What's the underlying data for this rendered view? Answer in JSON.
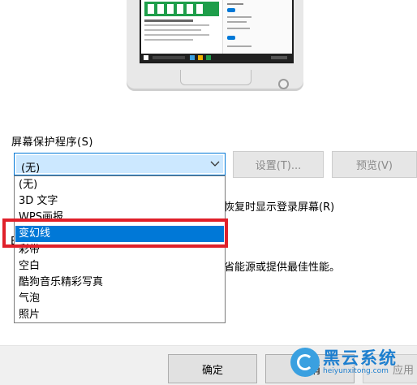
{
  "screensaver": {
    "group_label": "屏幕保护程序(S)",
    "selected_value": "(无)",
    "settings_button": "设置(T)...",
    "preview_button": "预览(V)",
    "options": [
      "(无)",
      "3D 文字",
      "WPS画报",
      "变幻线",
      "彩带",
      "空白",
      "酷狗音乐精彩写真",
      "气泡",
      "照片"
    ],
    "highlighted_index": 3,
    "resume_text": "恢复时显示登录屏幕(R)",
    "power_text": "省能源或提供最佳性能。",
    "partial_char": "E"
  },
  "dialog": {
    "ok_label": "确定",
    "cancel_label": "取消",
    "apply_label": "应用"
  },
  "watermark": {
    "title": "黑云系统",
    "url": "heiyunxitong.com"
  },
  "colors": {
    "accent": "#0078d7",
    "highlight_border": "#e0202a"
  }
}
